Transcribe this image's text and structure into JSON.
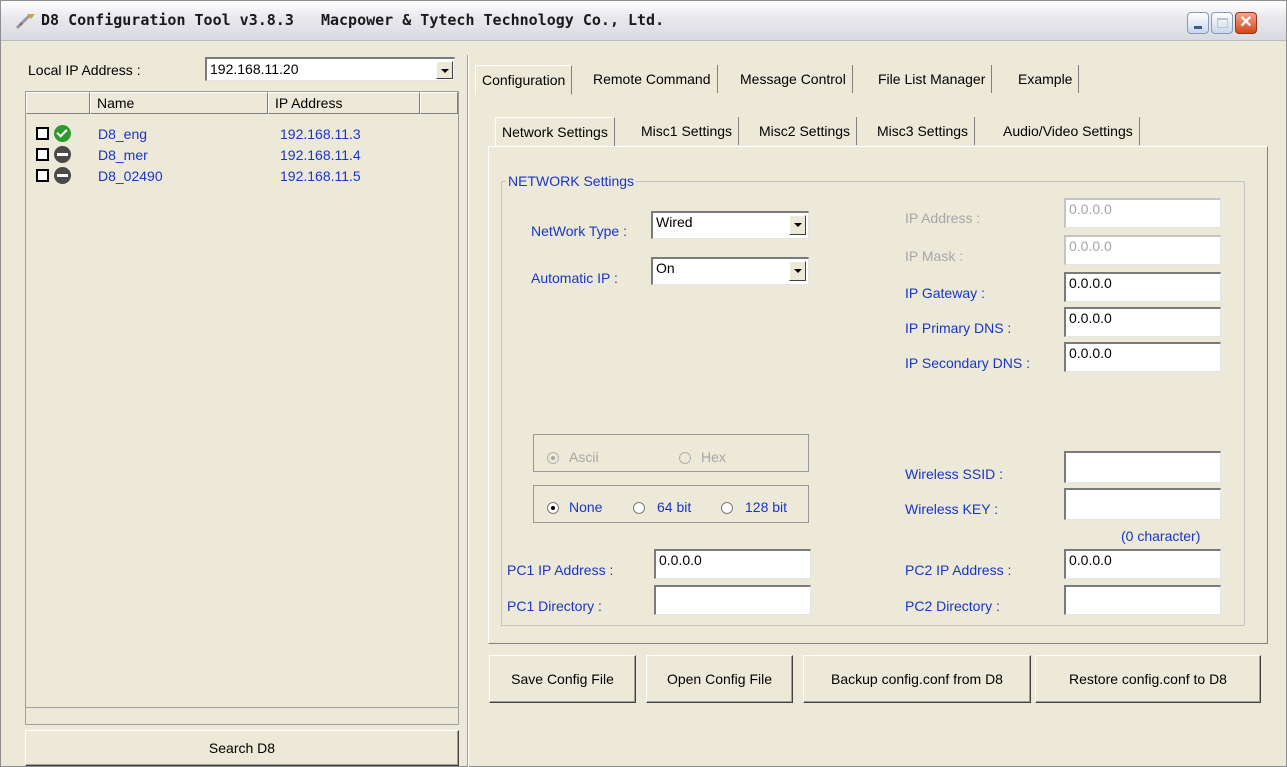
{
  "window": {
    "title": "D8 Configuration Tool v3.8.3   Macpower & Tytech Technology Co., Ltd.",
    "buttons": {
      "minimize": "minimize",
      "maximize": "maximize",
      "close": "✕"
    }
  },
  "left": {
    "local_ip_label": "Local IP Address :",
    "local_ip_value": "192.168.11.20",
    "columns": [
      "Name",
      "IP Address"
    ],
    "devices": [
      {
        "name": "D8_eng",
        "ip": "192.168.11.3",
        "status": "online",
        "checked": false
      },
      {
        "name": "D8_mer",
        "ip": "192.168.11.4",
        "status": "offline",
        "checked": false
      },
      {
        "name": "D8_02490",
        "ip": "192.168.11.5",
        "status": "offline",
        "checked": false
      }
    ],
    "search_button": "Search D8"
  },
  "main_tabs": [
    "Configuration",
    "Remote Command",
    "Message Control",
    "File List Manager",
    "Example"
  ],
  "sub_tabs": [
    "Network Settings",
    "Misc1 Settings",
    "Misc2 Settings",
    "Misc3 Settings",
    "Audio/Video Settings"
  ],
  "network": {
    "group_title": "NETWORK Settings",
    "network_type_label": "NetWork Type :",
    "network_type_value": "Wired",
    "automatic_ip_label": "Automatic IP :",
    "automatic_ip_value": "On",
    "ip_address_label": "IP Address :",
    "ip_address_value": "0.0.0.0",
    "ip_mask_label": "IP Mask :",
    "ip_mask_value": "0.0.0.0",
    "ip_gateway_label": "IP Gateway :",
    "ip_gateway_value": "0.0.0.0",
    "ip_primary_dns_label": "IP Primary DNS :",
    "ip_primary_dns_value": "0.0.0.0",
    "ip_secondary_dns_label": "IP Secondary DNS :",
    "ip_secondary_dns_value": "0.0.0.0",
    "key_format": {
      "ascii": "Ascii",
      "hex": "Hex",
      "selected": "ascii"
    },
    "encryption": {
      "none": "None",
      "bit64": "64 bit",
      "bit128": "128 bit",
      "selected": "none"
    },
    "wireless_ssid_label": "Wireless SSID :",
    "wireless_ssid_value": "",
    "wireless_key_label": "Wireless KEY :",
    "wireless_key_value": "",
    "char_count": "(0 character)",
    "pc1_ip_label": "PC1 IP Address :",
    "pc1_ip_value": "0.0.0.0",
    "pc1_dir_label": "PC1 Directory :",
    "pc1_dir_value": "",
    "pc2_ip_label": "PC2 IP Address :",
    "pc2_ip_value": "0.0.0.0",
    "pc2_dir_label": "PC2 Directory :",
    "pc2_dir_value": ""
  },
  "actions": {
    "save": "Save Config File",
    "open": "Open Config File",
    "backup": "Backup config.conf from D8",
    "restore": "Restore config.conf to D8"
  }
}
